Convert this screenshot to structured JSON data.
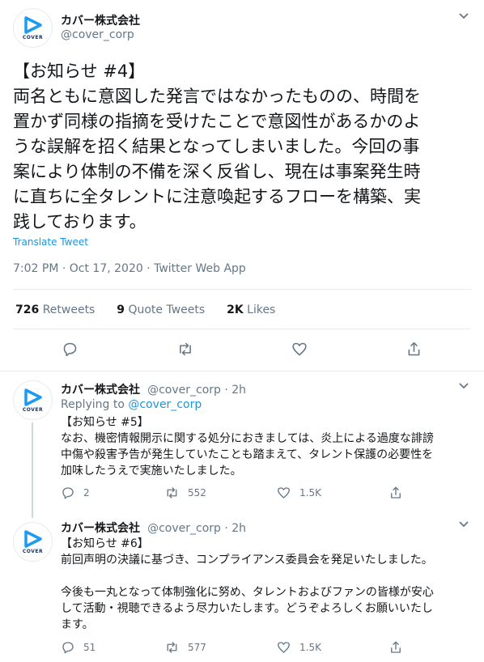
{
  "main_tweet": {
    "name": "カバー株式会社",
    "handle": "@cover_corp",
    "avatar_text": "COVER",
    "text": "【お知らせ #4】\n両名ともに意図した発言ではなかったものの、時間を\n置かず同様の指摘を受けたことで意図性があるかのよ\nうな誤解を招く結果となってしまいました。今回の事\n案により体制の不備を深く反省し、現在は事案発生時\nに直ちに全タレントに注意喚起するフローを構築、実\n践しております。",
    "translate": "Translate Tweet",
    "meta": "7:02 PM · Oct 17, 2020 · Twitter Web App",
    "retweets_count": "726",
    "retweets_label": "Retweets",
    "quotes_count": "9",
    "quotes_label": "Quote Tweets",
    "likes_count": "2K",
    "likes_label": "Likes"
  },
  "replies": [
    {
      "name": "カバー株式会社",
      "handle": "@cover_corp · 2h",
      "avatar_text": "COVER",
      "replying_prefix": "Replying to",
      "replying_to": "@cover_corp",
      "text": "【お知らせ #5】\nなお、機密情報開示に関する処分におきましては、炎上による過度な誹謗\n中傷や殺害予告が発生していたことも踏まえて、タレント保護の必要性を\n加味したうえで実施いたしました。",
      "reply_count": "2",
      "retweet_count": "552",
      "like_count": "1.5K"
    },
    {
      "name": "カバー株式会社",
      "handle": "@cover_corp · 2h",
      "avatar_text": "COVER",
      "text": "【お知らせ #6】\n前回声明の決議に基づき、コンプライアンス委員会を発足いたしました。\n\n今後も一丸となって体制強化に努め、タレントおよびファンの皆様が安心\nして活動・視聴できるよう尽力いたします。どうぞよろしくお願いいたし\nます。",
      "reply_count": "51",
      "retweet_count": "577",
      "like_count": "1.5K"
    }
  ],
  "colors": {
    "accent": "#1b95e0",
    "muted": "#657786",
    "text": "#14171a",
    "divider": "#e6ecf0",
    "logo_blue": "#1d9bf0"
  }
}
